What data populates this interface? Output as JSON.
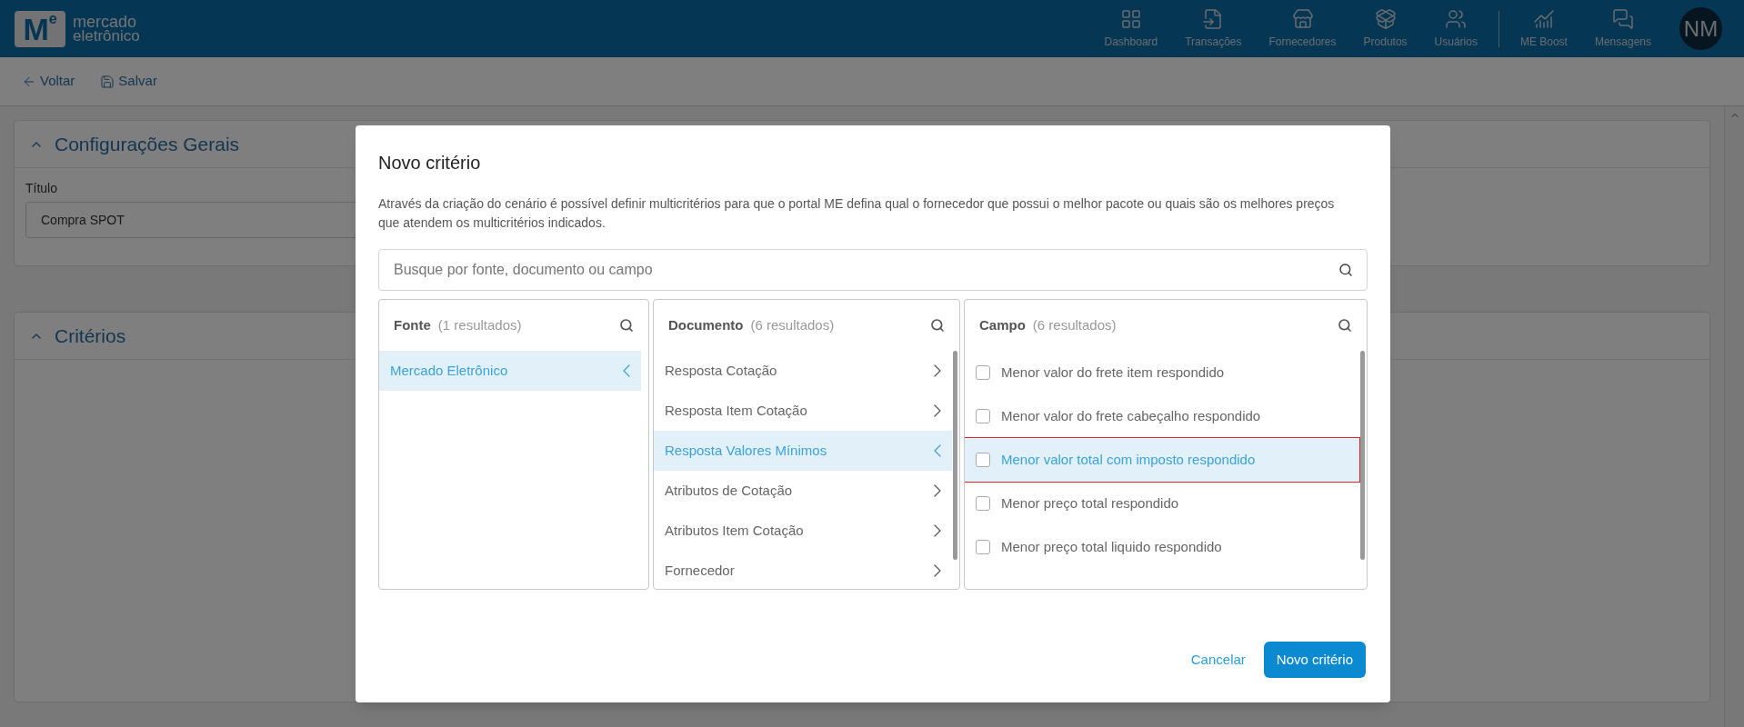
{
  "header": {
    "logo": {
      "mark": "M",
      "mark_small": "e",
      "line1": "mercado",
      "line2": "eletrônico"
    },
    "nav": [
      {
        "label": "Dashboard"
      },
      {
        "label": "Transações"
      },
      {
        "label": "Fornecedores"
      },
      {
        "label": "Produtos"
      },
      {
        "label": "Usuários"
      },
      {
        "label": "ME Boost"
      },
      {
        "label": "Mensagens"
      }
    ],
    "avatar": "NM"
  },
  "toolbar": [
    {
      "label": "Voltar"
    },
    {
      "label": "Salvar"
    }
  ],
  "general": {
    "title": "Configurações Gerais",
    "field_label": "Título",
    "field_value": "Compra SPOT"
  },
  "criteria": {
    "title": "Critérios"
  },
  "modal": {
    "title": "Novo critério",
    "description": "Através da criação do cenário é possível definir multicritérios para que o portal ME defina qual o fornecedor que possui o melhor pacote ou quais são os melhores preços que atendem os multicritérios indicados.",
    "search": {
      "placeholder": "Busque por fonte, documento ou campo"
    },
    "columns": [
      {
        "kind": "nav",
        "title": "Fonte",
        "count": "(1 resultados)",
        "items": [
          {
            "label": "Mercado Eletrônico",
            "selected": true
          }
        ]
      },
      {
        "kind": "nav",
        "title": "Documento",
        "count": "(6 resultados)",
        "items": [
          {
            "label": "Resposta Cotação",
            "selected": false
          },
          {
            "label": "Resposta Item Cotação",
            "selected": false
          },
          {
            "label": "Resposta Valores Mínimos",
            "selected": true
          },
          {
            "label": "Atributos de Cotação",
            "selected": false
          },
          {
            "label": "Atributos Item Cotação",
            "selected": false
          },
          {
            "label": "Fornecedor",
            "selected": false
          }
        ]
      },
      {
        "kind": "check",
        "title": "Campo",
        "count": "(6 resultados)",
        "items": [
          {
            "label": "Menor valor do frete item respondido",
            "checked": false,
            "selected": false
          },
          {
            "label": "Menor valor do frete cabeçalho respondido",
            "checked": false,
            "selected": false
          },
          {
            "label": "Menor valor total com imposto respondido",
            "checked": false,
            "selected": true
          },
          {
            "label": "Menor preço total respondido",
            "checked": false,
            "selected": false
          },
          {
            "label": "Menor preço total liquido respondido",
            "checked": false,
            "selected": false
          }
        ]
      }
    ],
    "buttons": {
      "cancel": "Cancelar",
      "confirm": "Novo critério"
    }
  }
}
